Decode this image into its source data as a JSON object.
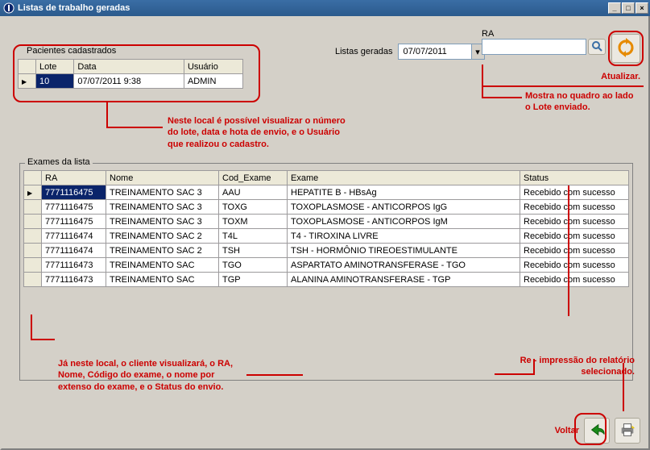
{
  "window": {
    "title": "Listas de trabalho geradas",
    "minimize": "_",
    "maximize": "□",
    "close": "×"
  },
  "top": {
    "listas_label": "Listas geradas",
    "date_value": "07/07/2011",
    "ra_label": "RA",
    "ra_value": "",
    "atualizar_label": "Atualizar.",
    "mostra_label": "Mostra no quadro ao lado o Lote enviado."
  },
  "pacientes": {
    "legend": "Pacientes cadastrados",
    "headers": {
      "lote": "Lote",
      "data": "Data",
      "usuario": "Usuário"
    },
    "rows": [
      {
        "lote": "10",
        "data": "07/07/2011 9:38",
        "usuario": "ADMIN"
      }
    ],
    "annot": "Neste local é possível visualizar o número do lote, data e hota de envio, e o Usuário que realizou o cadastro."
  },
  "exames": {
    "legend": "Exames da lista",
    "headers": {
      "ra": "RA",
      "nome": "Nome",
      "cod": "Cod_Exame",
      "exame": "Exame",
      "status": "Status"
    },
    "rows": [
      {
        "ra": "7771116475",
        "nome": "TREINAMENTO SAC 3",
        "cod": "AAU",
        "exame": "HEPATITE B - HBsAg",
        "status": "Recebido com sucesso"
      },
      {
        "ra": "7771116475",
        "nome": "TREINAMENTO SAC 3",
        "cod": "TOXG",
        "exame": "TOXOPLASMOSE - ANTICORPOS IgG",
        "status": "Recebido com sucesso"
      },
      {
        "ra": "7771116475",
        "nome": "TREINAMENTO SAC 3",
        "cod": "TOXM",
        "exame": "TOXOPLASMOSE - ANTICORPOS IgM",
        "status": "Recebido com sucesso"
      },
      {
        "ra": "7771116474",
        "nome": "TREINAMENTO SAC 2",
        "cod": "T4L",
        "exame": "T4 - TIROXINA LIVRE",
        "status": "Recebido com sucesso"
      },
      {
        "ra": "7771116474",
        "nome": "TREINAMENTO SAC 2",
        "cod": "TSH",
        "exame": "TSH - HORMÔNIO TIREOESTIMULANTE",
        "status": "Recebido com sucesso"
      },
      {
        "ra": "7771116473",
        "nome": "TREINAMENTO SAC",
        "cod": "TGO",
        "exame": "ASPARTATO AMINOTRANSFERASE - TGO",
        "status": "Recebido com sucesso"
      },
      {
        "ra": "7771116473",
        "nome": "TREINAMENTO SAC",
        "cod": "TGP",
        "exame": "ALANINA AMINOTRANSFERASE - TGP",
        "status": "Recebido com sucesso"
      }
    ],
    "annot_left": "Já neste local, o cliente visualizará, o RA, Nome, Código do exame, o nome por extenso do exame, e o Status do envio.",
    "annot_right": "Re - impressão do relatório selecionado."
  },
  "bottom": {
    "voltar_label": "Voltar"
  }
}
